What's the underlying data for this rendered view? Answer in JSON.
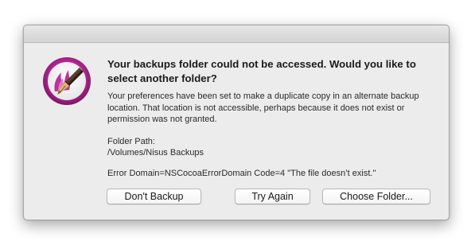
{
  "dialog": {
    "title": "Your backups folder could not be accessed. Would you like to select another folder?",
    "message": "Your preferences have been set to make a duplicate copy in an alternate backup location. That location is not accessible, perhaps because it does not exist or permission was not granted.",
    "folder_label": "Folder Path:",
    "folder_path": "/Volumes/Nisus Backups",
    "error": "Error Domain=NSCocoaErrorDomain Code=4 \"The file doesn’t exist.\"",
    "icon": "nisus-writer-pen-icon"
  },
  "buttons": {
    "dont_backup": "Don't Backup",
    "try_again": "Try Again",
    "choose_folder": "Choose Folder..."
  },
  "colors": {
    "icon_magenta": "#b0268f",
    "dialog_background": "#ececec"
  }
}
